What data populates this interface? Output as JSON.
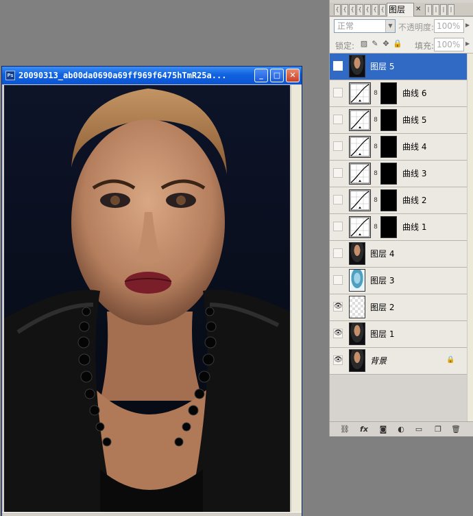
{
  "document": {
    "title": "20090313_ab00da0690a69ff969f6475hTmR25a...",
    "icon": "photoshop-doc-icon",
    "buttons": {
      "minimize": "_",
      "maximize": "□",
      "close": "✕"
    }
  },
  "layers_panel": {
    "tabs_collapsed": [
      "{",
      "{",
      "{",
      "{",
      "{",
      "{",
      "{"
    ],
    "active_tab": "图层",
    "tabs_after": [
      "|",
      "|",
      "|",
      "|"
    ],
    "blend_mode": "正常",
    "opacity_label": "不透明度:",
    "opacity_value": "100%",
    "lock_label": "锁定:",
    "fill_label": "填充:",
    "fill_value": "100%",
    "layers": [
      {
        "name": "图层 5",
        "type": "pixel",
        "thumb": "photo",
        "visible": false,
        "selected": true
      },
      {
        "name": "曲线 6",
        "type": "curves",
        "visible": false
      },
      {
        "name": "曲线 5",
        "type": "curves",
        "visible": false
      },
      {
        "name": "曲线 4",
        "type": "curves",
        "visible": false
      },
      {
        "name": "曲线 3",
        "type": "curves",
        "visible": false
      },
      {
        "name": "曲线 2",
        "type": "curves",
        "visible": false
      },
      {
        "name": "曲线 1",
        "type": "curves",
        "visible": false
      },
      {
        "name": "图层 4",
        "type": "pixel",
        "thumb": "photo",
        "visible": false
      },
      {
        "name": "图层 3",
        "type": "pixel",
        "thumb": "blue",
        "visible": false
      },
      {
        "name": "图层 2",
        "type": "pixel",
        "thumb": "transparent",
        "visible": true
      },
      {
        "name": "图层 1",
        "type": "pixel",
        "thumb": "photo",
        "visible": true
      },
      {
        "name": "背景",
        "type": "background",
        "thumb": "photo",
        "visible": true,
        "locked": true
      }
    ],
    "footer_icons": [
      "link-icon",
      "fx-icon",
      "mask-icon",
      "adjustment-icon",
      "group-folder-icon",
      "new-layer-icon",
      "trash-icon"
    ]
  }
}
